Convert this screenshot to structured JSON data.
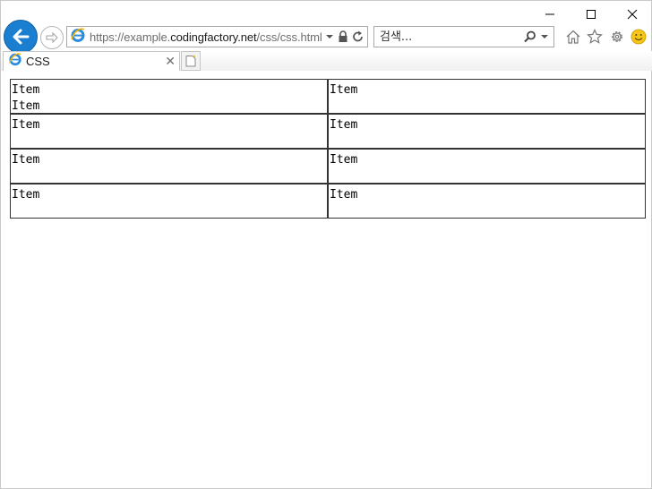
{
  "browser": {
    "url_scheme": "https://",
    "url_sub": "example.",
    "url_host": "codingfactory.net",
    "url_path": "/css/css.html",
    "search_placeholder": "검색...",
    "tab_title": "CSS",
    "tab_close_glyph": "✕",
    "icons": [
      "back-arrow-icon",
      "forward-arrow-icon",
      "ie-logo-icon",
      "lock-icon",
      "refresh-icon",
      "search-icon",
      "home-icon",
      "star-icon",
      "gear-icon",
      "smiley-icon",
      "new-tab-icon"
    ],
    "colors": {
      "back_button": "#1b7fd1",
      "smiley": "#f5c518"
    }
  },
  "page": {
    "cells": [
      {
        "lines": [
          "Item",
          "Item"
        ]
      },
      {
        "lines": [
          "Item"
        ]
      },
      {
        "lines": [
          "Item"
        ]
      },
      {
        "lines": [
          "Item"
        ]
      },
      {
        "lines": [
          "Item"
        ]
      },
      {
        "lines": [
          "Item"
        ]
      },
      {
        "lines": [
          "Item"
        ]
      },
      {
        "lines": [
          "Item"
        ]
      }
    ]
  }
}
